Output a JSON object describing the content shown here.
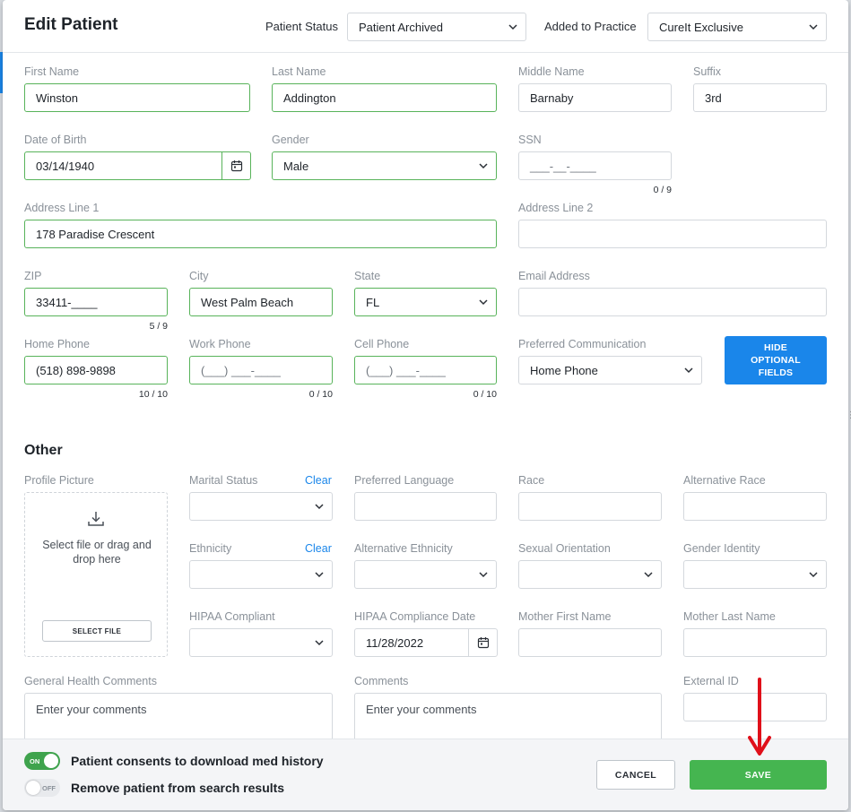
{
  "header": {
    "title": "Edit Patient",
    "patient_status_label": "Patient Status",
    "patient_status_value": "Patient Archived",
    "added_to_practice_label": "Added to Practice",
    "added_to_practice_value": "CureIt Exclusive"
  },
  "demographics": {
    "first_name": {
      "label": "First Name",
      "value": "Winston"
    },
    "last_name": {
      "label": "Last Name",
      "value": "Addington"
    },
    "middle_name": {
      "label": "Middle Name",
      "value": "Barnaby"
    },
    "suffix": {
      "label": "Suffix",
      "value": "3rd"
    },
    "dob": {
      "label": "Date of Birth",
      "value": "03/14/1940"
    },
    "gender": {
      "label": "Gender",
      "value": "Male"
    },
    "ssn": {
      "label": "SSN",
      "placeholder": "___-__-____",
      "counter": "0 / 9"
    },
    "address1": {
      "label": "Address Line 1",
      "value": "178 Paradise Crescent"
    },
    "address2": {
      "label": "Address Line 2",
      "value": ""
    },
    "zip": {
      "label": "ZIP",
      "value": "33411-____",
      "counter": "5 / 9"
    },
    "city": {
      "label": "City",
      "value": "West Palm Beach"
    },
    "state": {
      "label": "State",
      "value": "FL"
    },
    "email": {
      "label": "Email Address",
      "value": ""
    },
    "home_phone": {
      "label": "Home Phone",
      "value": "(518) 898-9898",
      "counter": "10 / 10"
    },
    "work_phone": {
      "label": "Work Phone",
      "placeholder": "(___) ___-____",
      "counter": "0 / 10"
    },
    "cell_phone": {
      "label": "Cell Phone",
      "placeholder": "(___) ___-____",
      "counter": "0 / 10"
    },
    "preferred_comm": {
      "label": "Preferred Communication",
      "value": "Home Phone"
    },
    "hide_optional_label": "HIDE OPTIONAL FIELDS"
  },
  "other": {
    "title": "Other",
    "profile_picture": {
      "label": "Profile Picture",
      "drop_text": "Select file or drag and drop here",
      "button": "SELECT FILE"
    },
    "marital_status": {
      "label": "Marital Status",
      "clear": "Clear"
    },
    "preferred_language": {
      "label": "Preferred Language"
    },
    "race": {
      "label": "Race"
    },
    "alternative_race": {
      "label": "Alternative Race"
    },
    "ethnicity": {
      "label": "Ethnicity",
      "clear": "Clear"
    },
    "alternative_ethnicity": {
      "label": "Alternative Ethnicity"
    },
    "sexual_orientation": {
      "label": "Sexual Orientation"
    },
    "gender_identity": {
      "label": "Gender Identity"
    },
    "hipaa_compliant": {
      "label": "HIPAA Compliant"
    },
    "hipaa_date": {
      "label": "HIPAA Compliance Date",
      "value": "11/28/2022"
    },
    "mother_first_name": {
      "label": "Mother First Name"
    },
    "mother_last_name": {
      "label": "Mother Last Name"
    },
    "general_comments": {
      "label": "General Health Comments",
      "placeholder": "Enter your comments"
    },
    "comments": {
      "label": "Comments",
      "placeholder": "Enter your comments"
    },
    "external_id": {
      "label": "External ID"
    }
  },
  "footer": {
    "consent_toggle": {
      "state_label": "ON",
      "text": "Patient consents to download med history"
    },
    "remove_toggle": {
      "state_label": "OFF",
      "text": "Remove patient from search results"
    },
    "cancel": "CANCEL",
    "save": "SAVE"
  },
  "colors": {
    "accent_blue": "#1a86ea",
    "valid_green": "#58b35a",
    "save_green": "#45b550",
    "annotation_red": "#e0101a"
  }
}
